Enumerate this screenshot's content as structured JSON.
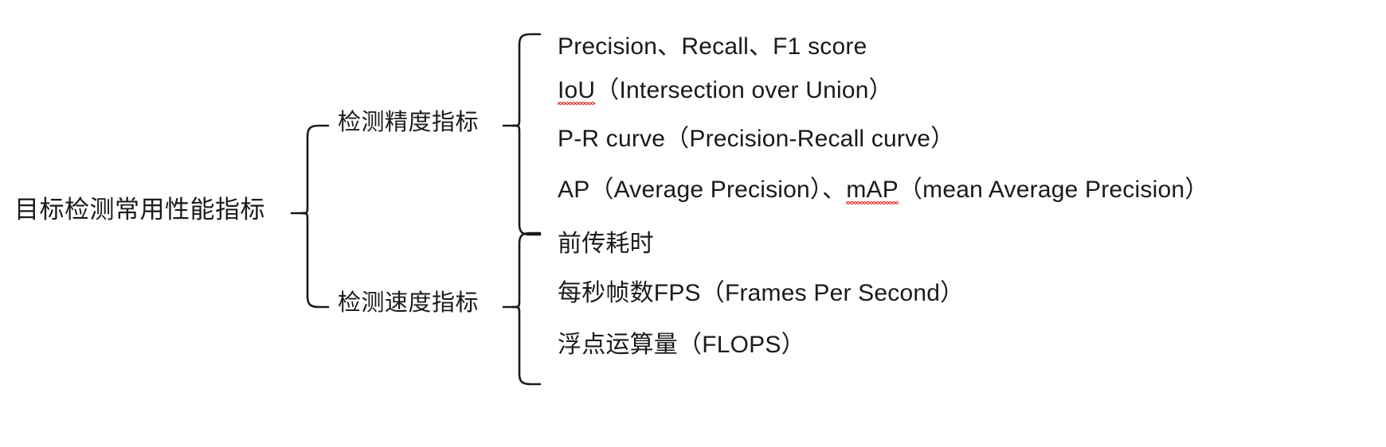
{
  "diagram": {
    "title": "目标检测常用性能指标",
    "type": "bracket-tree",
    "text_color": "#1a1a1a",
    "background_color": "#ffffff",
    "spellcheck_underline_color": "#e8332a",
    "root": {
      "label": "目标检测常用性能指标"
    },
    "branches": [
      {
        "id": "accuracy",
        "label": "检测精度指标",
        "leaves": [
          {
            "id": "precision-recall-f1",
            "text": "Precision、Recall、F1 score"
          },
          {
            "id": "iou",
            "spelled_term": "IoU",
            "rest": "（Intersection over Union）",
            "misspelled": true
          },
          {
            "id": "pr-curve",
            "text": "P-R curve（Precision-Recall curve）"
          },
          {
            "id": "ap-map",
            "prefix": "AP（Average Precision）、",
            "spelled_term": "mAP",
            "rest": "（mean Average Precision）",
            "misspelled": true
          }
        ]
      },
      {
        "id": "speed",
        "label": "检测速度指标",
        "leaves": [
          {
            "id": "forward-latency",
            "text": "前传耗时"
          },
          {
            "id": "fps",
            "text": "每秒帧数FPS（Frames Per Second）"
          },
          {
            "id": "flops",
            "text": "浮点运算量（FLOPS）"
          }
        ]
      }
    ]
  }
}
